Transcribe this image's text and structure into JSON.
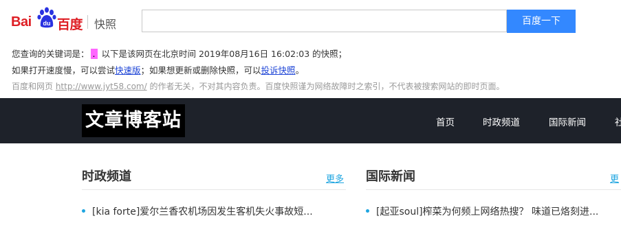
{
  "snapshot": {
    "logo": {
      "text_bai": "Bai",
      "text_du": "du",
      "text_cn": "百度"
    },
    "title": "快照",
    "search": {
      "value": "",
      "button_label": "百度一下"
    },
    "line1": {
      "prefix": "您查询的关键词是：",
      "keyword": ".",
      "suffix": "以下是该网页在北京时间 2019年08月16日 16:02:03 的快照；"
    },
    "line2": {
      "part1": "如果打开速度慢，可以尝试",
      "link1": "快速版",
      "part2": "；如果想更新或删除快照，可以",
      "link2": "投诉快照",
      "part3": "。"
    },
    "line3": {
      "part1": "百度和网页 ",
      "link": "http://www.jyt58.com/",
      "part2": " 的作者无关，不对其内容负责。百度快照谨为网络故障时之索引，不代表被搜索网站的即时页面。"
    }
  },
  "site": {
    "logo_text": "文章博客站",
    "nav": [
      "首页",
      "时政频道",
      "国际新闻",
      "社"
    ]
  },
  "sections": [
    {
      "title": "时政频道",
      "more": "更多",
      "items": [
        "[kia forte]爱尔兰香农机场因发生客机失火事故短..."
      ]
    },
    {
      "title": "国际新闻",
      "more": "更",
      "items": [
        "[起亚soul]榨菜为何频上网络热搜？ 味道已烙刻进..."
      ]
    }
  ],
  "colors": {
    "brand_red": "#de1e24",
    "brand_blue": "#3388ff",
    "nav_bg": "#1e222a",
    "accent": "#1ea5e0",
    "keyword_highlight": "#ff66ff"
  }
}
